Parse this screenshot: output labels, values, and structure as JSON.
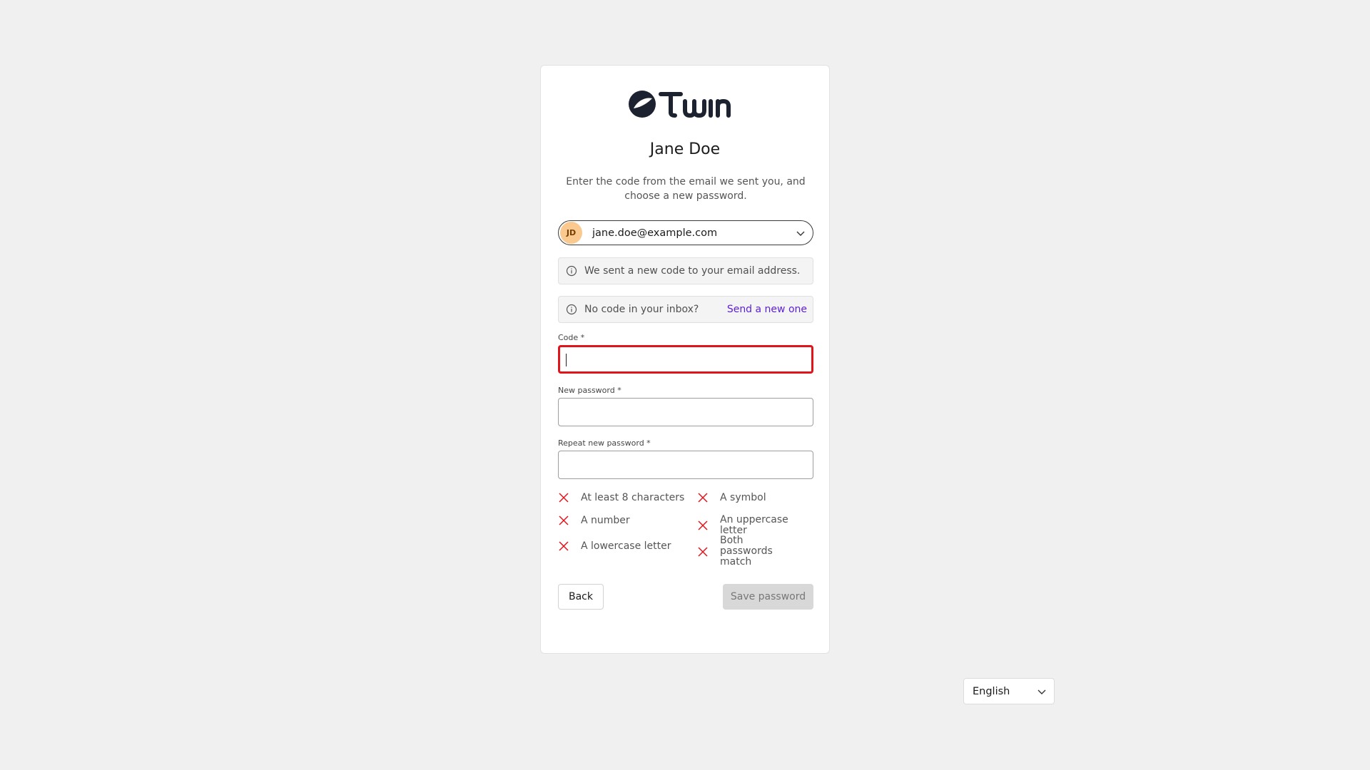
{
  "brand": {
    "name": "Twin"
  },
  "user": {
    "name": "Jane Doe",
    "initials": "JD",
    "email": "jane.doe@example.com"
  },
  "subtitle": "Enter the code from the email we sent you, and choose a new password.",
  "notices": {
    "sent": "We sent a new code to your email address.",
    "no_code": "No code in your inbox?",
    "resend_link": "Send a new one"
  },
  "fields": {
    "code": {
      "label": "Code *",
      "value": ""
    },
    "new_password": {
      "label": "New password *",
      "value": ""
    },
    "repeat_password": {
      "label": "Repeat new password *",
      "value": ""
    }
  },
  "requirements": [
    {
      "label": "At least 8 characters",
      "met": false
    },
    {
      "label": "A symbol",
      "met": false
    },
    {
      "label": "A number",
      "met": false
    },
    {
      "label": "An uppercase letter",
      "met": false
    },
    {
      "label": "A lowercase letter",
      "met": false
    },
    {
      "label": "Both passwords match",
      "met": false
    }
  ],
  "buttons": {
    "back": "Back",
    "save": "Save password"
  },
  "language": {
    "selected": "English"
  },
  "colors": {
    "error": "#e0151b",
    "link": "#5b1fd6",
    "avatar_bg": "#f9c98f"
  },
  "icons": {
    "info": "info-icon",
    "unmet": "x-icon",
    "dropdown": "chevron-down-icon"
  }
}
